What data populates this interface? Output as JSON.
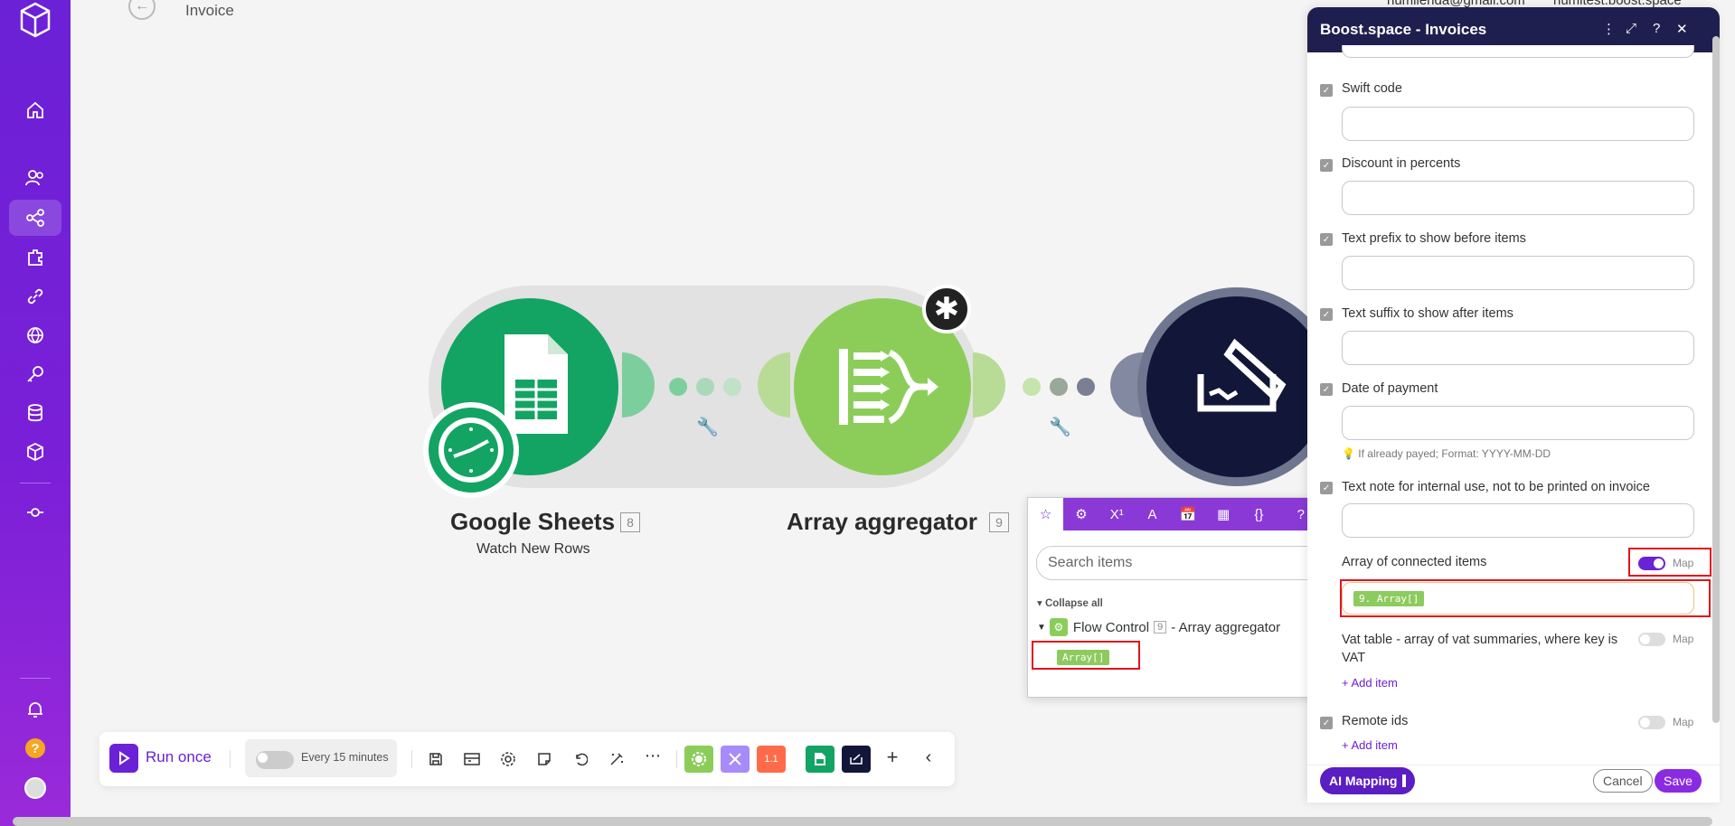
{
  "app": {
    "title": "Invoice",
    "user_email": "humlienda@gmail.com",
    "org_name": "humltest.boost.space"
  },
  "sidebar": {
    "icons": [
      "logo-icon",
      "home-icon",
      "team-icon",
      "scenarios-icon",
      "apps-icon",
      "connections-icon",
      "webhooks-icon",
      "keys-icon",
      "datastores-icon",
      "datastructures-icon",
      "devices-icon",
      "notifications-icon",
      "help-icon",
      "avatar-icon"
    ]
  },
  "canvas": {
    "modules": [
      {
        "title": "Google Sheets",
        "badge": "8",
        "subtitle": "Watch New Rows"
      },
      {
        "title": "Array aggregator",
        "badge": "9"
      }
    ]
  },
  "toolbar": {
    "run_label": "Run once",
    "schedule_label": "Every 15 minutes",
    "counter_label": "1.1"
  },
  "mapping_panel": {
    "search_placeholder": "Search items",
    "collapse_label": "Collapse all",
    "tree_group": "Flow Control",
    "tree_badge": "9",
    "tree_suffix": "- Array aggregator",
    "tree_item": "Array[]"
  },
  "module_panel": {
    "title": "Boost.space - Invoices",
    "fields": [
      {
        "label": "Swift code"
      },
      {
        "label": "Discount in percents"
      },
      {
        "label": "Text prefix to show before items"
      },
      {
        "label": "Text suffix to show after items"
      },
      {
        "label": "Date of payment",
        "hint": "If already payed; Format: YYYY-MM-DD"
      },
      {
        "label": "Text note for internal use, not to be printed on invoice"
      }
    ],
    "array_field": {
      "label": "Array of connected items",
      "map_label": "Map",
      "value": "9. Array[]"
    },
    "vat_field": {
      "label": "Vat table - array of vat summaries, where key is VAT",
      "map_label": "Map",
      "add_label": "Add item"
    },
    "remote_field": {
      "label": "Remote ids",
      "map_label": "Map",
      "add_label": "Add item"
    },
    "footer": {
      "ai_label": "AI Mapping",
      "cancel_label": "Cancel",
      "save_label": "Save"
    }
  }
}
